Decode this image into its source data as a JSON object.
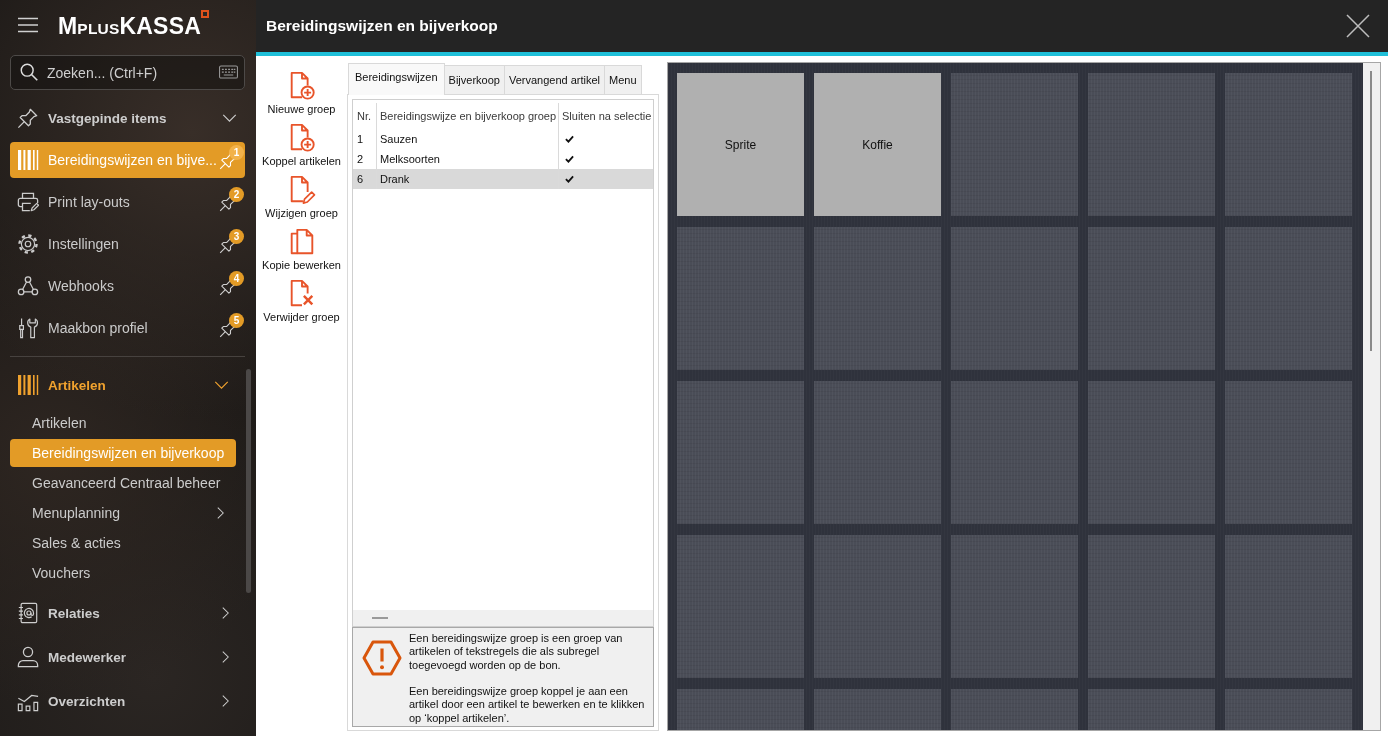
{
  "sidebar": {
    "logo": {
      "lead": "M",
      "small": "PLUS",
      "tail": "KASSA"
    },
    "search": {
      "placeholder": "Zoeken... (Ctrl+F)"
    },
    "pinned": {
      "label": "Vastgepinde items",
      "expanded": true,
      "items": [
        {
          "label": "Bereidingswijzen en bijve...",
          "badge": "1",
          "selected": true
        },
        {
          "label": "Print lay-outs",
          "badge": "2",
          "selected": false
        },
        {
          "label": "Instellingen",
          "badge": "3",
          "selected": false
        },
        {
          "label": "Webhooks",
          "badge": "4",
          "selected": false
        },
        {
          "label": "Maakbon profiel",
          "badge": "5",
          "selected": false
        }
      ]
    },
    "sections": [
      {
        "label": "Artikelen",
        "selected": true,
        "expanded": true,
        "children": [
          {
            "label": "Artikelen",
            "kind": "link",
            "selected": false
          },
          {
            "label": "Bereidingswijzen en bijverkoop",
            "kind": "link",
            "selected": true
          },
          {
            "label": "Geavanceerd Centraal beheer",
            "kind": "link",
            "selected": false
          },
          {
            "label": "Menuplanning",
            "kind": "submenu",
            "selected": false
          },
          {
            "label": "Sales & acties",
            "kind": "link",
            "selected": false
          },
          {
            "label": "Vouchers",
            "kind": "link",
            "selected": false
          }
        ]
      },
      {
        "label": "Relaties",
        "selected": false,
        "expanded": false
      },
      {
        "label": "Medewerker",
        "selected": false,
        "expanded": false
      },
      {
        "label": "Overzichten",
        "selected": false,
        "expanded": false
      }
    ]
  },
  "window": {
    "title": "Bereidingswijzen en bijverkoop"
  },
  "toolbar": [
    "Nieuwe groep",
    "Koppel artikelen",
    "Wijzigen groep",
    "Kopie bewerken",
    "Verwijder groep"
  ],
  "tabs": [
    {
      "label": "Bereidingswijzen",
      "selected": true
    },
    {
      "label": "Bijverkoop",
      "selected": false
    },
    {
      "label": "Vervangend artikel",
      "selected": false
    },
    {
      "label": "Menu",
      "selected": false
    }
  ],
  "table": {
    "columns": [
      "Nr.",
      "Bereidingswijze en bijverkoop groep",
      "Sluiten na selectie"
    ],
    "rows": [
      {
        "nr": "1",
        "name": "Sauzen",
        "checked": true,
        "selected": false
      },
      {
        "nr": "2",
        "name": "Melksoorten",
        "checked": true,
        "selected": false
      },
      {
        "nr": "6",
        "name": "Drank",
        "checked": true,
        "selected": true
      }
    ]
  },
  "info": {
    "paragraphs": [
      "Een bereidingswijze groep is een groep van artikelen of tekstregels die als subregel toegevoegd worden op de bon.",
      "Een bereidingswijze groep koppel je aan een artikel door een artikel te bewerken en te klikken op ‘koppel artikelen’."
    ]
  },
  "tiles": [
    {
      "kind": "product",
      "label": "Sprite"
    },
    {
      "kind": "product",
      "label": "Koffie"
    },
    {
      "kind": "empty"
    },
    {
      "kind": "empty"
    },
    {
      "kind": "empty"
    },
    {
      "kind": "empty"
    },
    {
      "kind": "empty"
    },
    {
      "kind": "empty"
    },
    {
      "kind": "empty"
    },
    {
      "kind": "empty"
    },
    {
      "kind": "empty"
    },
    {
      "kind": "empty"
    },
    {
      "kind": "empty"
    },
    {
      "kind": "empty"
    },
    {
      "kind": "empty"
    },
    {
      "kind": "empty"
    },
    {
      "kind": "empty"
    },
    {
      "kind": "empty"
    },
    {
      "kind": "empty"
    },
    {
      "kind": "empty"
    },
    {
      "kind": "empty"
    },
    {
      "kind": "empty"
    },
    {
      "kind": "empty"
    },
    {
      "kind": "empty"
    },
    {
      "kind": "empty"
    }
  ]
}
